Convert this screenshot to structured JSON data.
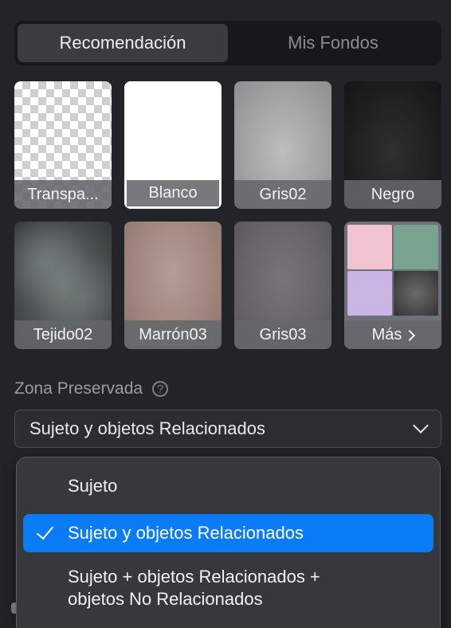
{
  "tabs": [
    {
      "label": "Recomendación",
      "active": true
    },
    {
      "label": "Mis Fondos",
      "active": false
    }
  ],
  "backgrounds": [
    {
      "label": "Transpa...",
      "style": "transparent-checker"
    },
    {
      "label": "Blanco",
      "style": "white",
      "selected": true
    },
    {
      "label": "Gris02",
      "style": "gray-gradient"
    },
    {
      "label": "Negro",
      "style": "black-gradient"
    },
    {
      "label": "Tejido02",
      "style": "texture-gray"
    },
    {
      "label": "Marrón03",
      "style": "brown-gradient"
    },
    {
      "label": "Gris03",
      "style": "dark-gray-gradient"
    },
    {
      "label": "Más",
      "style": "more-collage"
    }
  ],
  "preserved_zone": {
    "title": "Zona Preservada",
    "help_icon": "?",
    "selected_value": "Sujeto y objetos Relacionados"
  },
  "dropdown": {
    "options": [
      {
        "label": "Sujeto",
        "checked": false
      },
      {
        "label": "Sujeto y objetos Relacionados",
        "checked": true
      },
      {
        "label_line1": "Sujeto + objetos Relacionados +",
        "label_line2": "objetos No Relacionados",
        "checked": false
      }
    ]
  },
  "colors": {
    "panel_bg": "#222427",
    "accent_highlight": "#0a7cf5",
    "selected_outline": "#ffffff"
  }
}
